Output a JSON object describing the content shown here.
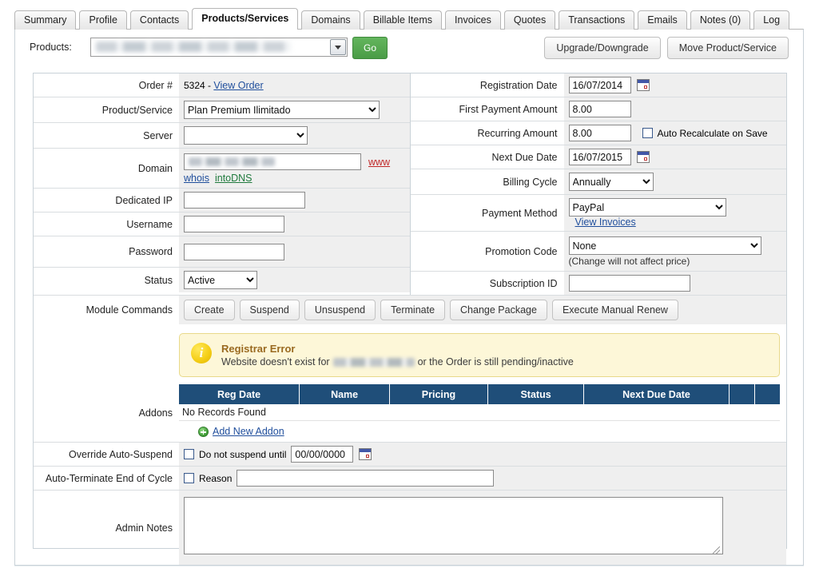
{
  "tabs": [
    {
      "label": "Summary",
      "active": false
    },
    {
      "label": "Profile",
      "active": false
    },
    {
      "label": "Contacts",
      "active": false
    },
    {
      "label": "Products/Services",
      "active": true
    },
    {
      "label": "Domains",
      "active": false
    },
    {
      "label": "Billable Items",
      "active": false
    },
    {
      "label": "Invoices",
      "active": false
    },
    {
      "label": "Quotes",
      "active": false
    },
    {
      "label": "Transactions",
      "active": false
    },
    {
      "label": "Emails",
      "active": false
    },
    {
      "label": "Notes (0)",
      "active": false
    },
    {
      "label": "Log",
      "active": false
    }
  ],
  "toolbar": {
    "products_label": "Products:",
    "products_value": "",
    "go_label": "Go",
    "upgrade_label": "Upgrade/Downgrade",
    "move_label": "Move Product/Service"
  },
  "left": {
    "order_label": "Order #",
    "order_number": "5324 -",
    "order_link": "View Order",
    "product_label": "Product/Service",
    "product_value": "Plan Premium Ilimitado",
    "server_label": "Server",
    "server_value": "",
    "domain_label": "Domain",
    "domain_value": "",
    "www_link": "www",
    "whois_link": "whois",
    "intodns_link": "intoDNS",
    "dedicated_ip_label": "Dedicated IP",
    "dedicated_ip_value": "",
    "username_label": "Username",
    "username_value": "",
    "password_label": "Password",
    "password_value": "",
    "status_label": "Status",
    "status_value": "Active"
  },
  "right": {
    "registration_date_label": "Registration Date",
    "registration_date_value": "16/07/2014",
    "first_payment_label": "First Payment Amount",
    "first_payment_value": "8.00",
    "recurring_label": "Recurring Amount",
    "recurring_value": "8.00",
    "auto_recalculate_label": "Auto Recalculate on Save",
    "next_due_label": "Next Due Date",
    "next_due_value": "16/07/2015",
    "billing_cycle_label": "Billing Cycle",
    "billing_cycle_value": "Annually",
    "payment_method_label": "Payment Method",
    "payment_method_value": "PayPal",
    "view_invoices_link": "View Invoices",
    "promotion_code_label": "Promotion Code",
    "promotion_code_value": "None",
    "promotion_note": "(Change will not affect price)",
    "subscription_id_label": "Subscription ID",
    "subscription_id_value": ""
  },
  "module_commands": {
    "label": "Module Commands",
    "buttons": [
      "Create",
      "Suspend",
      "Unsuspend",
      "Terminate",
      "Change Package",
      "Execute Manual Renew"
    ]
  },
  "alert": {
    "title": "Registrar Error",
    "body_prefix": "Website doesn't exist for",
    "body_suffix": "or the Order is still pending/inactive"
  },
  "addons": {
    "label": "Addons",
    "columns": [
      "Reg Date",
      "Name",
      "Pricing",
      "Status",
      "Next Due Date",
      "",
      ""
    ],
    "empty_text": "No Records Found",
    "add_link": "Add New Addon"
  },
  "override": {
    "label": "Override Auto-Suspend",
    "checkbox_label": "Do not suspend until",
    "date_value": "00/00/0000"
  },
  "auto_terminate": {
    "label": "Auto-Terminate End of Cycle",
    "checkbox_label": "Reason",
    "reason_value": ""
  },
  "admin_notes": {
    "label": "Admin Notes",
    "value": ""
  },
  "colors": {
    "accent_blue": "#1f4e79",
    "go_green": "#4a9c46",
    "alert_bg": "#fdf7d8",
    "alert_title": "#9a6a20",
    "link": "#1f4e9c"
  }
}
